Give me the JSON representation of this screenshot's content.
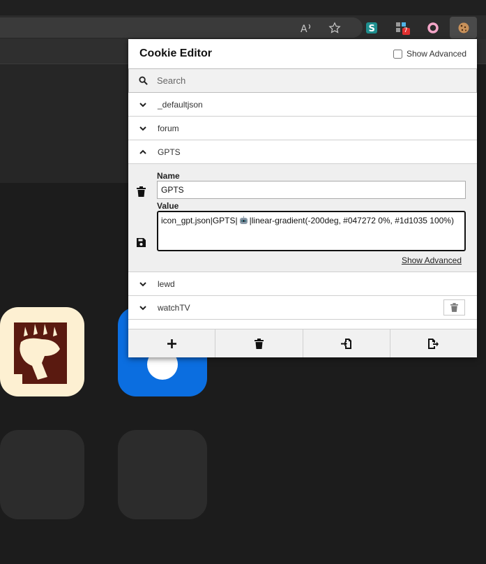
{
  "popup": {
    "title": "Cookie Editor",
    "show_advanced_label": "Show Advanced",
    "search_placeholder": "Search",
    "cookies": [
      {
        "name": "_defaultjson"
      },
      {
        "name": "forum"
      },
      {
        "name": "GPTS"
      },
      {
        "name": "lewd"
      },
      {
        "name": "watchTV"
      }
    ],
    "expanded": {
      "name_label": "Name",
      "name_value": "GPTS",
      "value_label": "Value",
      "value_text_before_icon": "icon_gpt.json|GPTS|",
      "value_text_after_icon": "|linear-gradient(-200deg, #047272 0%, #1d1035 100%)",
      "show_advanced_link": "Show Advanced"
    }
  },
  "toolbar": {
    "extension_badge": "7"
  },
  "colors": {
    "tile_bear_bg": "#fdf0d2",
    "bear_brown": "#5a1a10",
    "tile_blue": "#0b6ee0"
  }
}
